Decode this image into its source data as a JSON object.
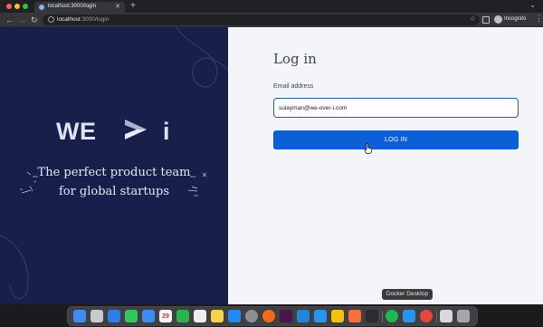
{
  "browser": {
    "tab": {
      "title": "localhost:3000/login"
    },
    "url": {
      "host": "localhost",
      "path": ":3000/login"
    },
    "profile_label": "Incognito"
  },
  "hero": {
    "logo": {
      "left": "WE",
      "right": "i"
    },
    "tagline": {
      "line1": "The perfect product team",
      "line2": "for global startups"
    },
    "background_color": "#16204a"
  },
  "login": {
    "title": "Log in",
    "email_label": "Email address",
    "email_value": "sulayman@we-over-i.com",
    "button_label": "LOG IN",
    "button_color": "#0b5fd7"
  },
  "dock": {
    "tooltip": "Docker Desktop",
    "apps": [
      {
        "name": "finder-icon",
        "color": "#3d8ef0"
      },
      {
        "name": "launchpad-icon",
        "color": "#c9c9d1"
      },
      {
        "name": "safari-icon",
        "color": "#2f7bea"
      },
      {
        "name": "messages-icon",
        "color": "#33c659"
      },
      {
        "name": "mail-icon",
        "color": "#3a8df0"
      },
      {
        "name": "calendar-icon",
        "color": "#f5f5f5"
      },
      {
        "name": "facetime-icon",
        "color": "#2bb34c"
      },
      {
        "name": "reminders-icon",
        "color": "#eeeeee"
      },
      {
        "name": "notes-icon",
        "color": "#f6d349"
      },
      {
        "name": "appstore-icon",
        "color": "#1f8cf5"
      },
      {
        "name": "system-settings-icon",
        "color": "#8e8e93"
      },
      {
        "name": "firefox-icon",
        "color": "#f26a1b"
      },
      {
        "name": "slack-icon",
        "color": "#4a154b"
      },
      {
        "name": "vscode-icon",
        "color": "#1f86d8"
      },
      {
        "name": "docker-icon",
        "color": "#2496ed"
      },
      {
        "name": "drive-icon",
        "color": "#f4c20d"
      },
      {
        "name": "postman-icon",
        "color": "#ff6c37"
      },
      {
        "name": "terminal-icon",
        "color": "#2c2c2e"
      },
      {
        "name": "spotify-icon",
        "color": "#1db954"
      },
      {
        "name": "docker-desktop-icon",
        "color": "#2496ed"
      },
      {
        "name": "chrome-icon",
        "color": "#e8453c"
      },
      {
        "name": "document-icon",
        "color": "#d9d9dc"
      },
      {
        "name": "trash-icon",
        "color": "#a5a5aa"
      }
    ],
    "calendar_day": "29"
  }
}
